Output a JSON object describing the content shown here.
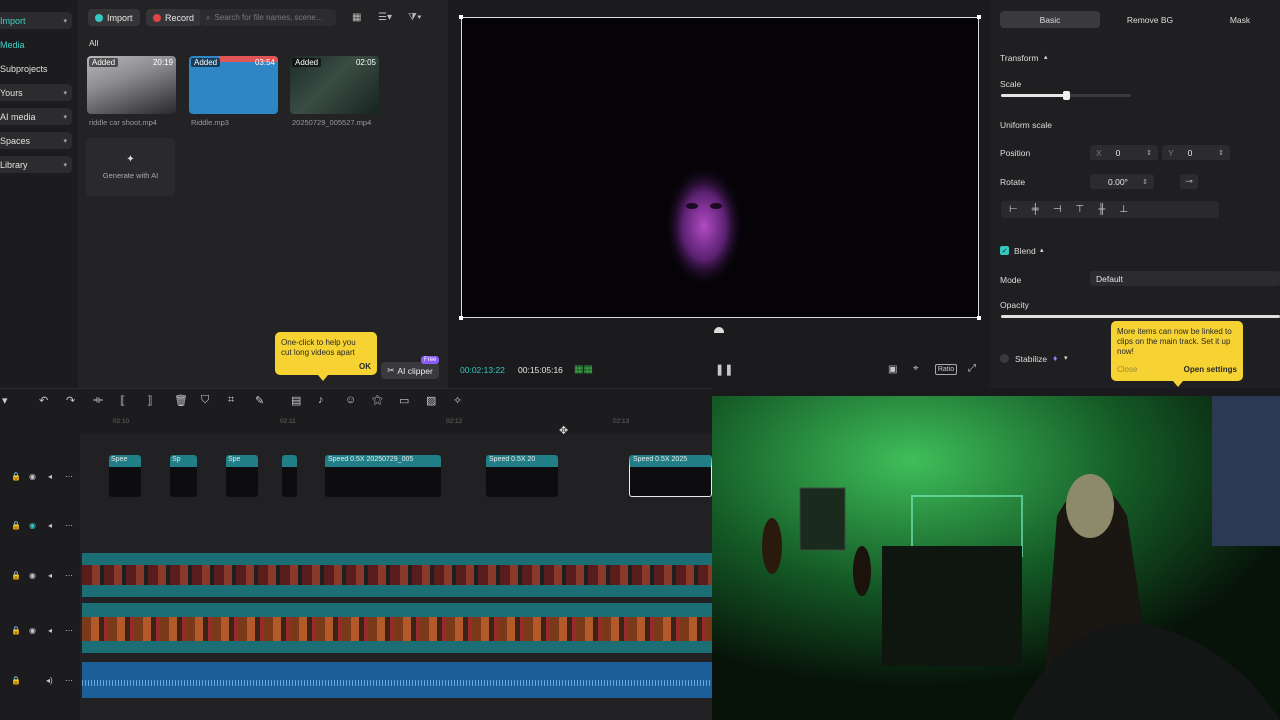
{
  "nav": {
    "import_label": "Import",
    "items": [
      {
        "label": "Media"
      },
      {
        "label": "Subprojects"
      },
      {
        "label": "Yours"
      },
      {
        "label": "AI media"
      },
      {
        "label": "Spaces"
      },
      {
        "label": "Library"
      }
    ]
  },
  "media": {
    "import_button": "Import",
    "record_button": "Record",
    "search_placeholder": "Search for file names, scene...",
    "filter_all": "All",
    "files": [
      {
        "badge": "Added",
        "duration": "20:19",
        "name": "riddle car shoot.mp4"
      },
      {
        "badge": "Added",
        "duration": "03:54",
        "name": "Riddle.mp3"
      },
      {
        "badge": "Added",
        "duration": "02:05",
        "name": "20250729_005527.mp4"
      }
    ],
    "generate_label": "Generate with AI",
    "tooltip_text": "One-click to help you cut long videos apart",
    "tooltip_ok": "OK",
    "ai_clipper_label": "AI clipper",
    "free_badge": "Free"
  },
  "player": {
    "current_time": "00:02:13:22",
    "total_time": "00:15:05:16",
    "ratio_label": "Ratio"
  },
  "properties": {
    "tabs": [
      "Basic",
      "Remove BG",
      "Mask"
    ],
    "transform_label": "Transform",
    "scale_label": "Scale",
    "scale_value": 0.5,
    "uniform_scale_label": "Uniform scale",
    "position_label": "Position",
    "pos_x_label": "X",
    "pos_x_value": "0",
    "pos_y_label": "Y",
    "pos_y_value": "0",
    "rotate_label": "Rotate",
    "rotate_value": "0.00°",
    "blend_label": "Blend",
    "mode_label": "Mode",
    "mode_value": "Default",
    "opacity_label": "Opacity",
    "stabilize_label": "Stabilize",
    "tooltip_text": "More items can now be linked to clips on the main track. Set it up now!",
    "tooltip_close": "Close",
    "tooltip_open": "Open settings"
  },
  "timeline": {
    "ruler_labels": [
      "02:10",
      "02:11",
      "02:12",
      "02:13"
    ],
    "clips": [
      {
        "label": "Spee"
      },
      {
        "label": "Sp"
      },
      {
        "label": "Spe"
      },
      {
        "label": ""
      },
      {
        "label": "Speed 0.5X  20250729_005"
      },
      {
        "label": "Speed 0.5X  20"
      },
      {
        "label": "Speed 0.5X  2025"
      }
    ]
  },
  "colors": {
    "accent": "#35c8c0",
    "tooltip": "#f6d232",
    "record": "#e14444",
    "free_badge": "#8a5cf5"
  }
}
